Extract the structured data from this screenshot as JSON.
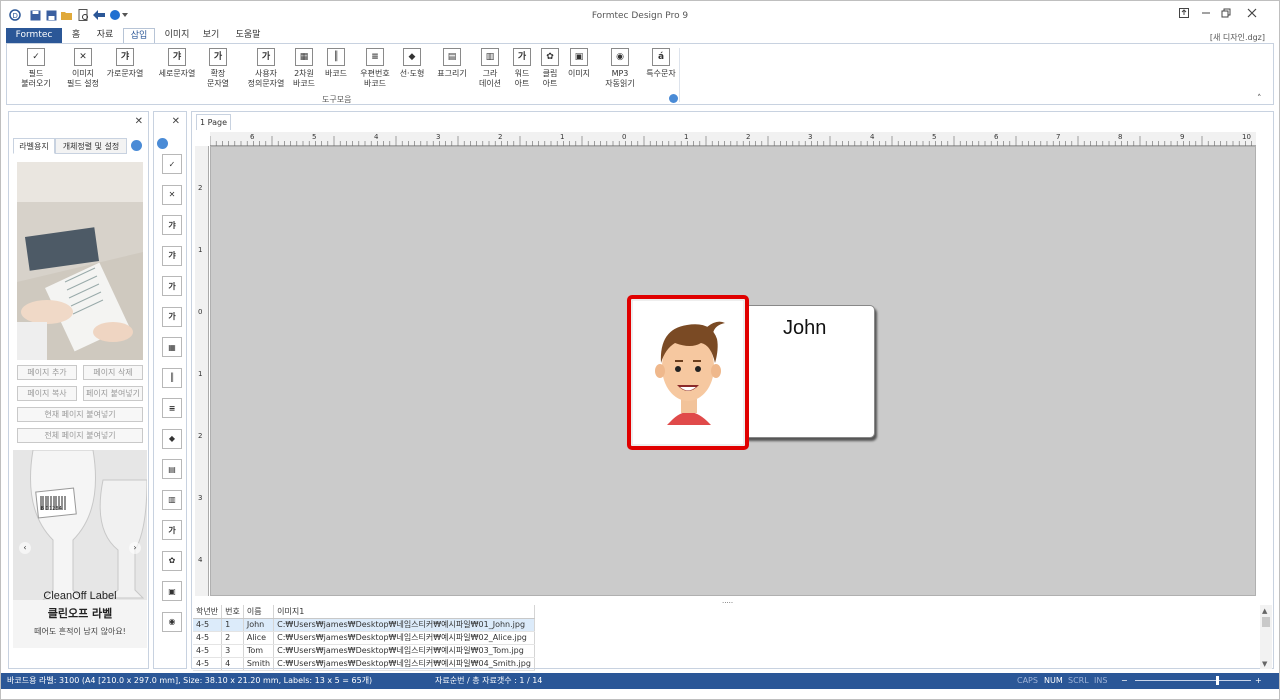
{
  "app": {
    "title": "Formtec Design Pro 9",
    "document": "[새 디자인.dgz]"
  },
  "tabs": {
    "formtec": "Formtec",
    "items": [
      "홈",
      "자료",
      "삽입",
      "이미지",
      "보기",
      "도움말"
    ]
  },
  "ribbon": {
    "group_label": "도구모음",
    "buttons": [
      {
        "label": "필드\n불러오기",
        "glyph": "✓"
      },
      {
        "label": "이미지\n필드 설정",
        "glyph": "✕"
      },
      {
        "label": "가로문자열",
        "glyph": "갸"
      },
      {
        "label": "세로문자열",
        "glyph": "갸"
      },
      {
        "label": "확장\n문자열",
        "glyph": "가"
      },
      {
        "label": "사용자\n정의문자열",
        "glyph": "가"
      },
      {
        "label": "2차원\n바코드",
        "glyph": "▦"
      },
      {
        "label": "바코드",
        "glyph": "║"
      },
      {
        "label": "우편번호\n바코드",
        "glyph": "≡"
      },
      {
        "label": "선·도형",
        "glyph": "◆"
      },
      {
        "label": "표그리기",
        "glyph": "▤"
      },
      {
        "label": "그라\n데이션",
        "glyph": "▥"
      },
      {
        "label": "워드\n아트",
        "glyph": "가"
      },
      {
        "label": "클립\n아트",
        "glyph": "✿"
      },
      {
        "label": "이미지",
        "glyph": "▣"
      },
      {
        "label": "MP3\n자동읽기",
        "glyph": "◉"
      },
      {
        "label": "특수문자",
        "glyph": "á"
      }
    ]
  },
  "left_panel": {
    "tabs": [
      "라벨용지",
      "개체정렬 및 설정"
    ],
    "buttons": {
      "add_page": "페이지 추가",
      "delete_page": "페이지 삭제",
      "copy_page": "페이지 복사",
      "paste_page": "페이지 붙여넣기",
      "paste_current": "현재 페이지 붙여넣기",
      "paste_all": "전체 페이지 붙여넣기"
    },
    "ad": {
      "brand": "CleanOff Label",
      "brand_kr": "클린오프 라벨",
      "tagline": "떼어도 흔적이 남지 않아요!",
      "barcode_text": "8 01234"
    }
  },
  "document": {
    "page_tab": "1 Page",
    "label_text": "John",
    "hruler": [
      "6",
      "5",
      "4",
      "3",
      "2",
      "1",
      "0",
      "1",
      "2",
      "3",
      "4",
      "5",
      "6",
      "7",
      "8",
      "9",
      "10"
    ],
    "vruler": [
      "2",
      "1",
      "0",
      "1",
      "2",
      "3",
      "4"
    ]
  },
  "table": {
    "headers": [
      "학년반",
      "번호",
      "이름",
      "이미지1"
    ],
    "rows": [
      [
        "4-5",
        "1",
        "John",
        "C:₩Users₩james₩Desktop₩네임스티커₩예시파일₩01_John.jpg"
      ],
      [
        "4-5",
        "2",
        "Alice",
        "C:₩Users₩james₩Desktop₩네임스티커₩예시파일₩02_Alice.jpg"
      ],
      [
        "4-5",
        "3",
        "Tom",
        "C:₩Users₩james₩Desktop₩네임스티커₩예시파일₩03_Tom.jpg"
      ],
      [
        "4-5",
        "4",
        "Smith",
        "C:₩Users₩james₩Desktop₩네임스티커₩예시파일₩04_Smith.jpg"
      ]
    ]
  },
  "status": {
    "label_info": "바코드용 라벨: 3100 (A4 [210.0 x 297.0 mm], Size: 38.10 x 21.20 mm,  Labels: 13 x 5 = 65개)",
    "record_info": "자료순번 / 총 자료갯수 : 1 / 14",
    "caps": "CAPS",
    "num": "NUM",
    "scrl": "SCRL",
    "ins": "INS"
  },
  "colors": {
    "accent": "#2b5797",
    "highlight": "#e00000"
  }
}
